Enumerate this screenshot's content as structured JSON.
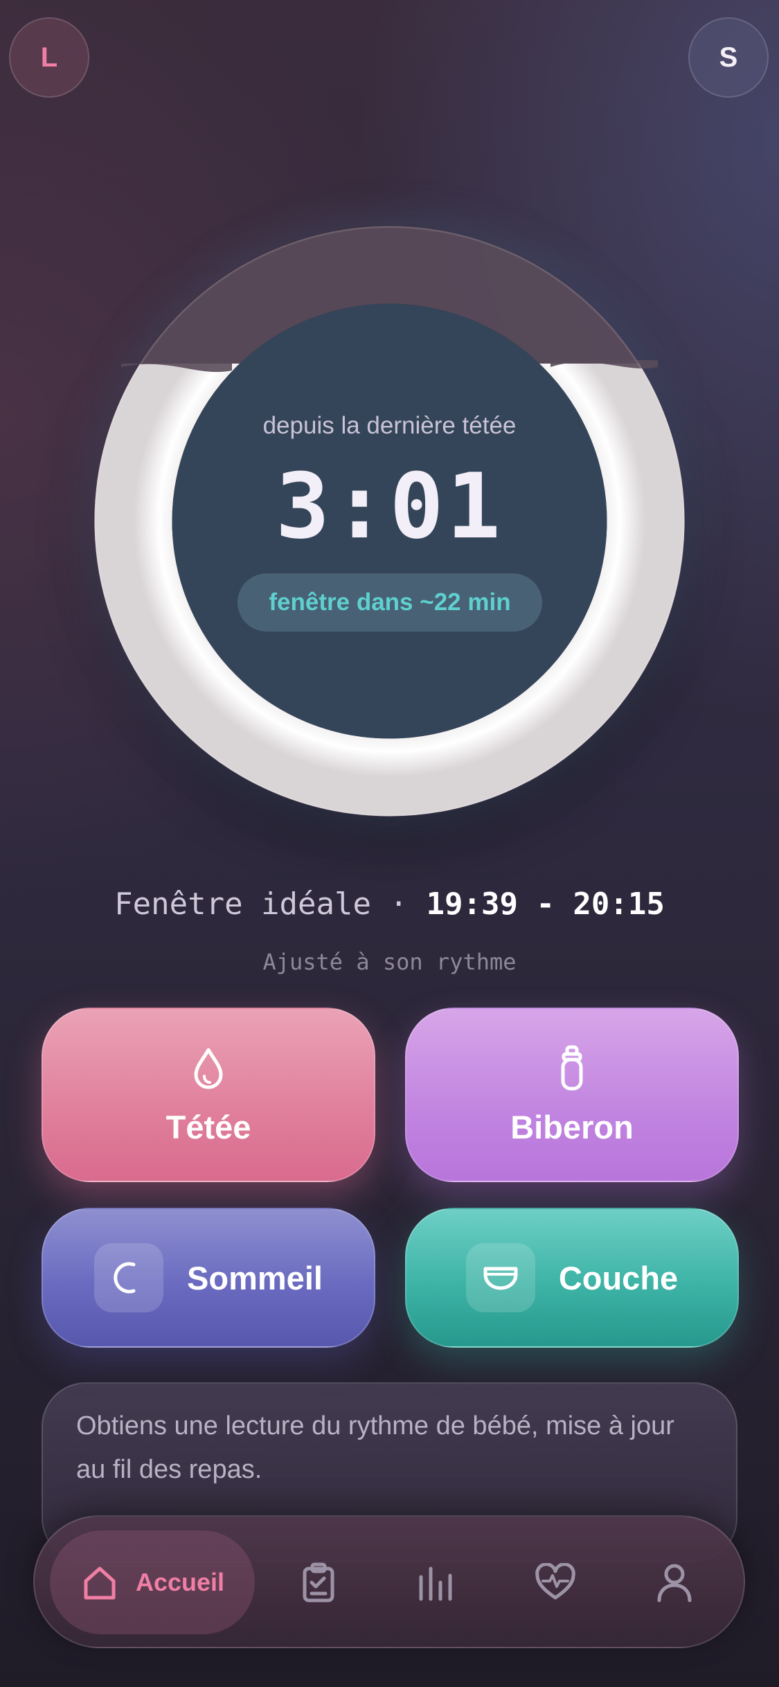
{
  "header": {
    "left_avatar": "L",
    "right_avatar": "S"
  },
  "timer": {
    "label": "depuis la dernière tétée",
    "elapsed": "3:01",
    "window_hint": "fenêtre dans ~22 min",
    "progress_fraction": 0.8
  },
  "ideal_window": {
    "label": "Fenêtre idéale",
    "separator": "·",
    "range": "19:39 - 20:15",
    "subtitle": "Ajusté à son rythme"
  },
  "actions": {
    "tetee": "Tétée",
    "biberon": "Biberon",
    "sommeil": "Sommeil",
    "couche": "Couche"
  },
  "insight": {
    "text": "Obtiens une lecture du rythme de bébé, mise à jour au fil des repas."
  },
  "tabbar": {
    "home_label": "Accueil",
    "icons": [
      "home-icon",
      "clipboard-check-icon",
      "bar-chart-icon",
      "heart-pulse-icon",
      "user-icon"
    ]
  },
  "colors": {
    "accent_pink": "#f07fa5",
    "teal": "#5fd0cf",
    "tetee": "#e07f9c",
    "biberon": "#c184e0",
    "sommeil": "#6a6bc0",
    "couche": "#3db3a6"
  }
}
